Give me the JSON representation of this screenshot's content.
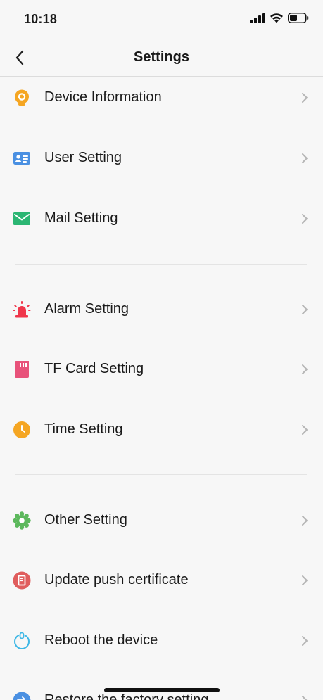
{
  "status_bar": {
    "time": "10:18"
  },
  "nav": {
    "title": "Settings",
    "back_icon": "chevron-left-icon"
  },
  "colors": {
    "device_info": "#f5a623",
    "user_setting": "#4a90e2",
    "mail_setting": "#2bb673",
    "alarm_setting": "#f0364b",
    "tf_card": "#e8527a",
    "time_setting": "#f5a623",
    "other_setting": "#5cb85c",
    "update_push": "#e05d5d",
    "reboot": "#3fb8e6",
    "restore": "#4a90e2"
  },
  "settings": {
    "items": [
      {
        "label": "Device Information",
        "icon": "camera-icon"
      },
      {
        "label": "User Setting",
        "icon": "user-card-icon"
      },
      {
        "label": "Mail Setting",
        "icon": "mail-icon"
      },
      {
        "label": "Alarm Setting",
        "icon": "alarm-icon"
      },
      {
        "label": "TF Card Setting",
        "icon": "sd-card-icon"
      },
      {
        "label": "Time Setting",
        "icon": "clock-icon"
      },
      {
        "label": "Other Setting",
        "icon": "gear-icon"
      },
      {
        "label": "Update push certificate",
        "icon": "certificate-icon"
      },
      {
        "label": "Reboot the device",
        "icon": "power-icon"
      },
      {
        "label": "Restore the factory setting",
        "icon": "restore-icon"
      }
    ]
  }
}
